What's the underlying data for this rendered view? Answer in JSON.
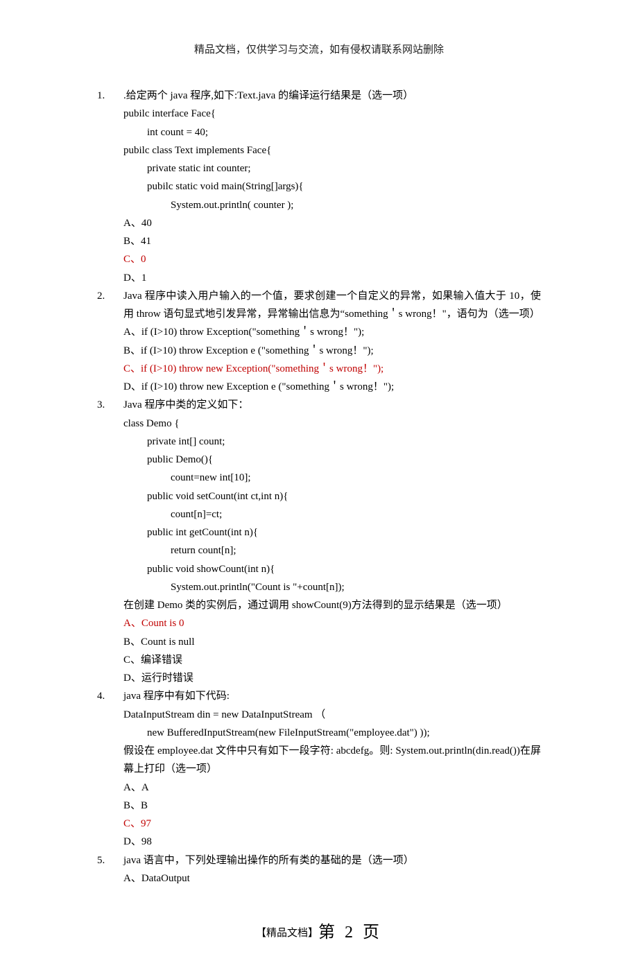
{
  "header": "精品文档，仅供学习与交流，如有侵权请联系网站删除",
  "footer": {
    "label": "【精品文档】",
    "page_prefix": "第 ",
    "page_num": "2",
    "page_suffix": " 页"
  },
  "questions": [
    {
      "num": "1.",
      "stem": [
        ".给定两个 java 程序,如下:Text.java 的编译运行结果是（选一项）",
        "pubilc interface Face{",
        "    int count = 40;",
        "pubilc class Text implements Face{",
        "    private static int counter;",
        "    pubilc static void main(String[]args){",
        "        System.out.println( counter );"
      ],
      "options": [
        {
          "text": "A、40",
          "correct": false
        },
        {
          "text": "B、41",
          "correct": false
        },
        {
          "text": "C、0",
          "correct": true
        },
        {
          "text": "D、1",
          "correct": false
        }
      ]
    },
    {
      "num": "2.",
      "stem": [
        "Java 程序中读入用户输入的一个值，要求创建一个自定义的异常，如果输入值大于 10，使用 throw 语句显式地引发异常，异常输出信息为“something＇s wrong！\"，语句为（选一项）"
      ],
      "options": [
        {
          "text": "A、if (I>10)    throw Exception(\"something＇s wrong！\");",
          "correct": false
        },
        {
          "text": "B、if (I>10)    throw Exception e (\"something＇s wrong！\");",
          "correct": false
        },
        {
          "text": "C、if (I>10)    throw new Exception(\"something＇s wrong！\");",
          "correct": true
        },
        {
          "text": "D、if (I>10) throw new Exception e (\"something＇s wrong！\");",
          "correct": false
        }
      ]
    },
    {
      "num": "3.",
      "stem": [
        "Java 程序中类的定义如下：",
        "class Demo {",
        "        private int[] count;",
        "        public Demo(){",
        "                count=new int[10];",
        "        public void setCount(int ct,int n){",
        "                count[n]=ct;",
        "        public int getCount(int n){",
        "                return count[n];",
        "        public void showCount(int n){",
        "                System.out.println(\"Count is \"+count[n]);",
        "在创建 Demo 类的实例后，通过调用 showCount(9)方法得到的显示结果是（选一项）"
      ],
      "options": [
        {
          "text": "A、Count is 0",
          "correct": true
        },
        {
          "text": "B、Count is null",
          "correct": false
        },
        {
          "text": "C、编译错误",
          "correct": false
        },
        {
          "text": "D、运行时错误",
          "correct": false
        }
      ]
    },
    {
      "num": "4.",
      "stem": [
        "java 程序中有如下代码:",
        "DataInputStream din = new DataInputStream   （",
        "        new BufferedInputStream(new FileInputStream(\"employee.dat\") ));",
        "假设在 employee.dat 文件中只有如下一段字符: abcdefg。则: System.out.println(din.read())在屏幕上打印（选一项）"
      ],
      "options": [
        {
          "text": "A、A",
          "correct": false
        },
        {
          "text": "B、B",
          "correct": false
        },
        {
          "text": "C、97",
          "correct": true
        },
        {
          "text": "D、98",
          "correct": false
        }
      ]
    },
    {
      "num": "5.",
      "stem": [
        "java 语言中，下列处理输出操作的所有类的基础的是（选一项）"
      ],
      "options": [
        {
          "text": "A、DataOutput",
          "correct": false
        }
      ]
    }
  ]
}
